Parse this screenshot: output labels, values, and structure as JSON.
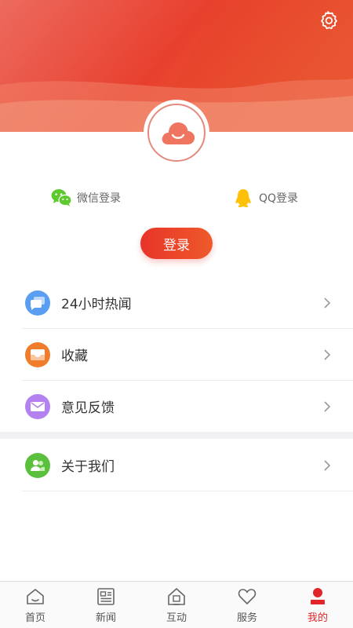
{
  "header": {
    "settings_icon": "gear-icon",
    "gradient": [
      "#ec6a5a",
      "#e8392b",
      "#f07a3f"
    ]
  },
  "avatar": {
    "icon": "cloud-smile-icon",
    "color": "#ef7560"
  },
  "social_login": {
    "wechat": {
      "label": "微信登录",
      "icon": "wechat-icon",
      "color": "#5cc92c"
    },
    "qq": {
      "label": "QQ登录",
      "icon": "qq-penguin-icon",
      "color": "#ffc107"
    }
  },
  "login_button": {
    "label": "登录"
  },
  "menu": [
    {
      "label": "24小时热闻",
      "icon": "chat-bubble-icon",
      "color": "#5a9ef2"
    },
    {
      "label": "收藏",
      "icon": "inbox-icon",
      "color": "#ef7d2b"
    },
    {
      "label": "意见反馈",
      "icon": "mail-icon",
      "color": "#b482f0"
    },
    {
      "label": "关于我们",
      "icon": "users-icon",
      "color": "#5cc03f"
    }
  ],
  "tabbar": {
    "active": "我的",
    "active_color": "#e0262a",
    "tabs": [
      {
        "label": "首页",
        "icon": "home-icon"
      },
      {
        "label": "新闻",
        "icon": "newspaper-icon"
      },
      {
        "label": "互动",
        "icon": "interact-house-icon"
      },
      {
        "label": "服务",
        "icon": "heart-icon"
      },
      {
        "label": "我的",
        "icon": "user-icon"
      }
    ]
  }
}
